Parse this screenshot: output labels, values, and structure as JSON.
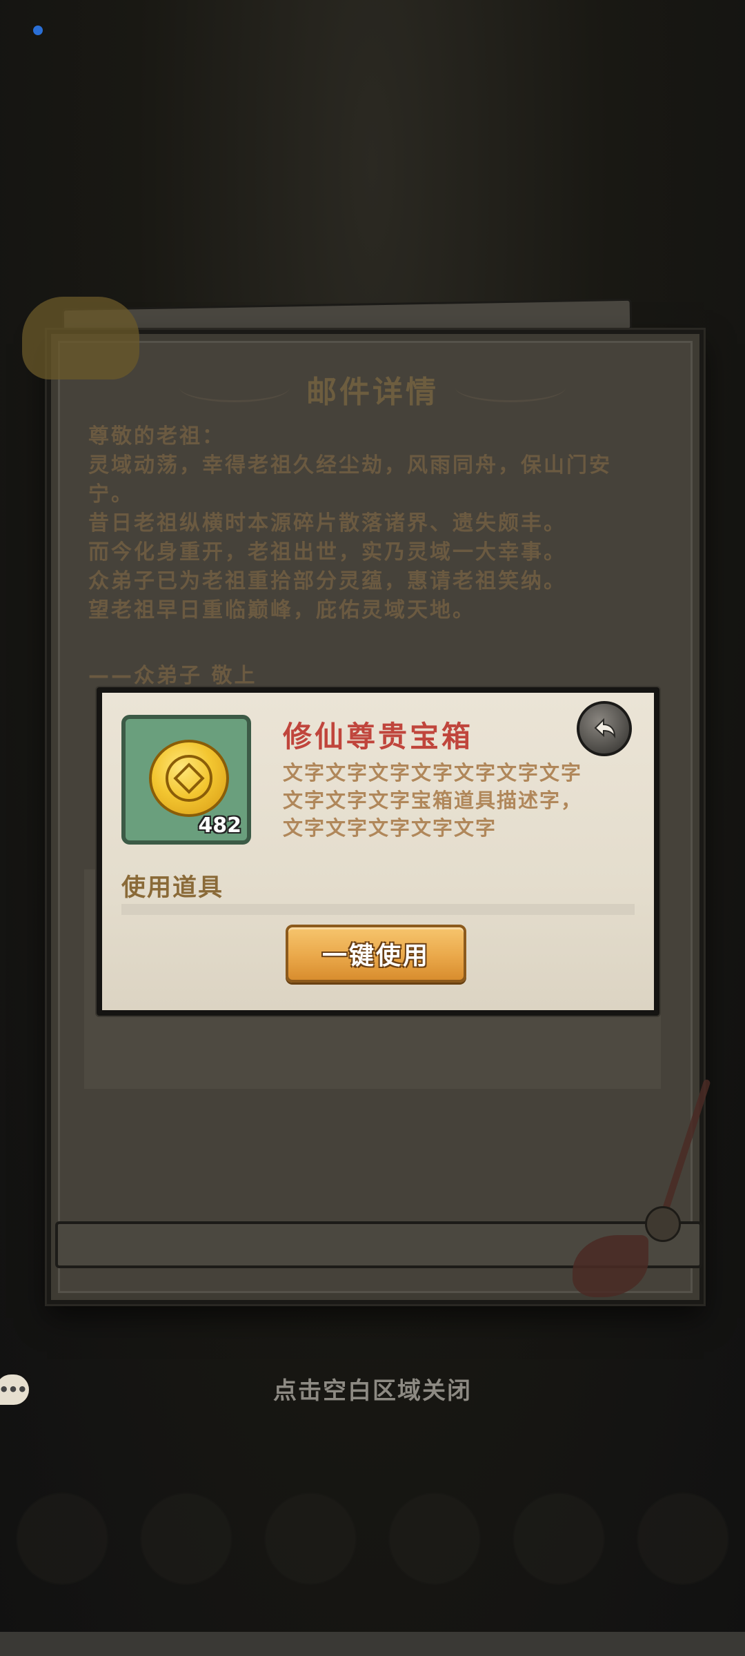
{
  "mail": {
    "title": "邮件详情",
    "greeting": "尊敬的老祖：",
    "body_lines": [
      "灵域动荡，幸得老祖久经尘劫，风雨同舟，保山门安",
      "宁。",
      "昔日老祖纵横时本源碎片散落诸界、遗失颇丰。",
      "而今化身重开，老祖出世，实乃灵域一大幸事。",
      "众弟子已为老祖重拾部分灵蕴，惠请老祖笑纳。",
      "望老祖早日重临巅峰，庇佑灵域天地。"
    ],
    "signature": "——众弟子 敬上"
  },
  "item_popup": {
    "name": "修仙尊贵宝箱",
    "count": "482",
    "description_lines": [
      "文字文字文字文字文字文字文字",
      "文字文字文字宝箱道具描述字，",
      "文字文字文字文字文字"
    ],
    "use_label": "使用道具",
    "use_all_button": "一键使用",
    "icon": "gold-coin-icon"
  },
  "close_hint": "点击空白区域关闭",
  "colors": {
    "item_name": "#c0453c",
    "description": "#b0875a",
    "button": "#eaa84a",
    "item_bg": "#6a9f7d"
  }
}
